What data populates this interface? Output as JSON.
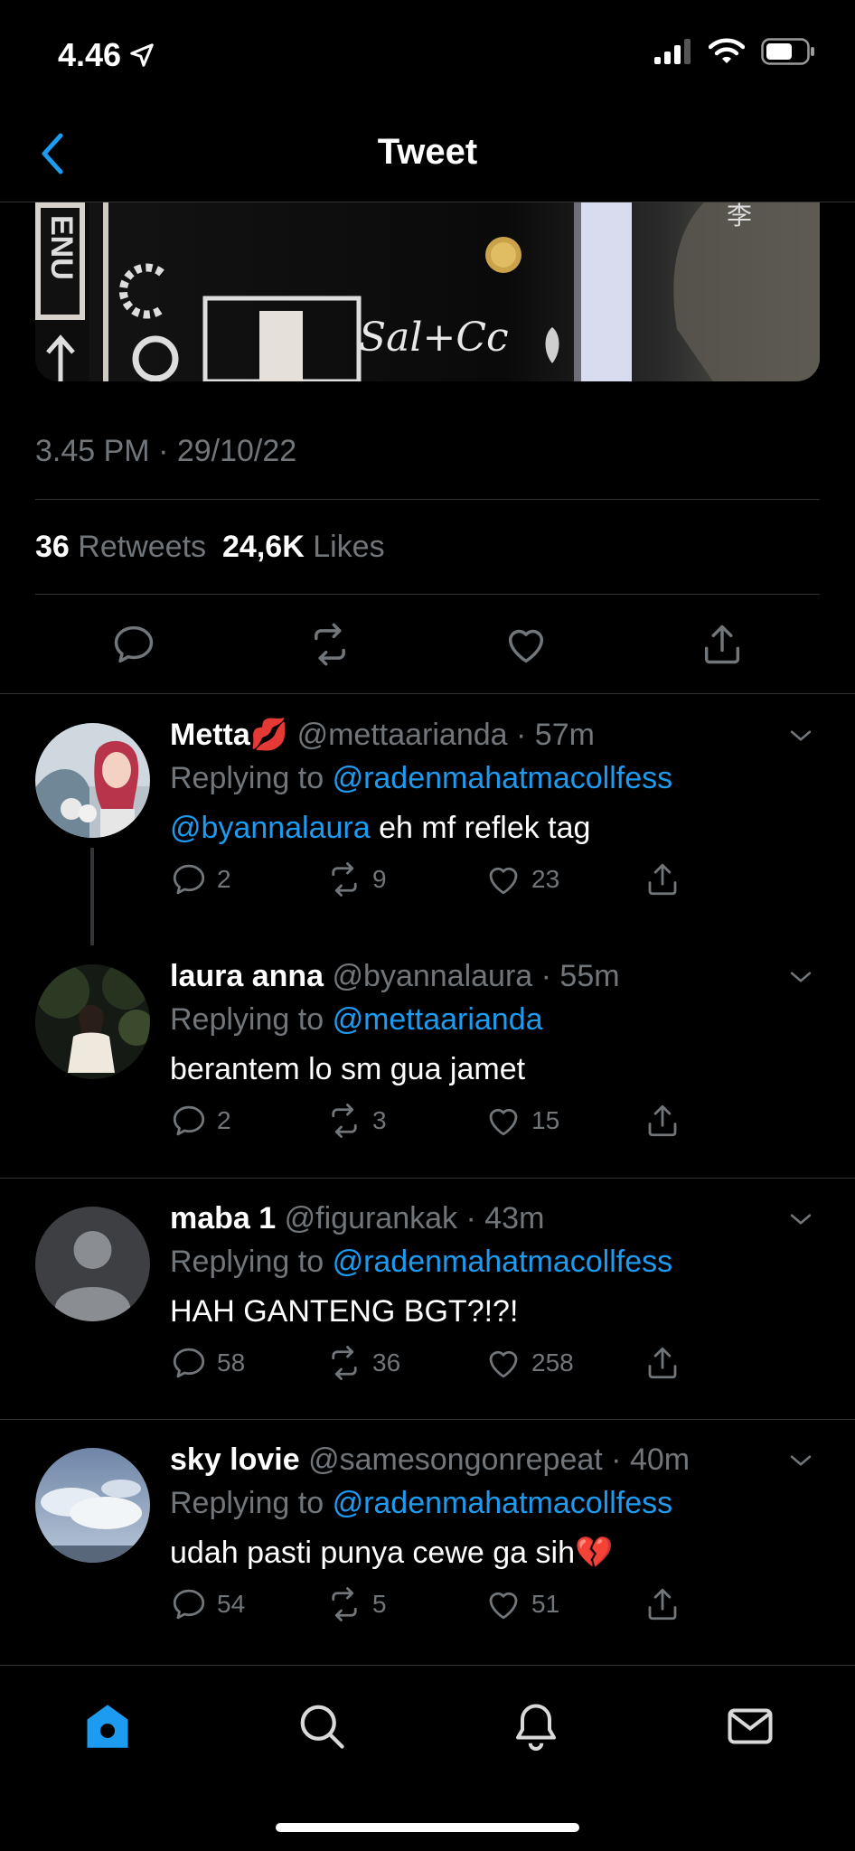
{
  "status_bar": {
    "time": "4.46"
  },
  "nav": {
    "title": "Tweet"
  },
  "media": {
    "signature_text": "Sal+Cc",
    "side_text": "ENU"
  },
  "tweet": {
    "timestamp": "3.45 PM · 29/10/22",
    "retweets_count": "36",
    "retweets_label": "Retweets",
    "likes_count": "24,6K",
    "likes_label": "Likes"
  },
  "replies": [
    {
      "name": "Metta",
      "name_emoji": "💋",
      "handle": "@mettaarianda",
      "time": "57m",
      "replying_prefix": "Replying to",
      "replying_to": "@radenmahatmacollfess",
      "mention": "@byannalaura",
      "text": " eh mf reflek tag",
      "replies": "2",
      "retweets": "9",
      "likes": "23"
    },
    {
      "name": "laura anna",
      "handle": "@byannalaura",
      "time": "55m",
      "replying_prefix": "Replying to",
      "replying_to": "@mettaarianda",
      "text": "berantem lo sm gua jamet",
      "replies": "2",
      "retweets": "3",
      "likes": "15"
    },
    {
      "name": "maba 1",
      "handle": "@figurankak",
      "time": "43m",
      "replying_prefix": "Replying to",
      "replying_to": "@radenmahatmacollfess",
      "text": "HAH GANTENG BGT?!?!",
      "replies": "58",
      "retweets": "36",
      "likes": "258"
    },
    {
      "name": "sky lovie",
      "handle": "@samesongonrepeat",
      "time": "40m",
      "replying_prefix": "Replying to",
      "replying_to": "@radenmahatmacollfess",
      "text": "udah pasti punya cewe ga sih",
      "text_emoji": "💔",
      "replies": "54",
      "retweets": "5",
      "likes": "51"
    }
  ],
  "colors": {
    "accent": "#1d9bf0",
    "muted": "#71767b",
    "background": "#000000",
    "divider": "#2f3336"
  },
  "icons": [
    "navigation-arrow-icon",
    "signal-icon",
    "wifi-icon",
    "battery-icon",
    "back-chevron-icon",
    "reply-icon",
    "retweet-icon",
    "like-icon",
    "share-icon",
    "chevron-down-icon",
    "home-icon",
    "search-icon",
    "bell-icon",
    "mail-icon"
  ]
}
